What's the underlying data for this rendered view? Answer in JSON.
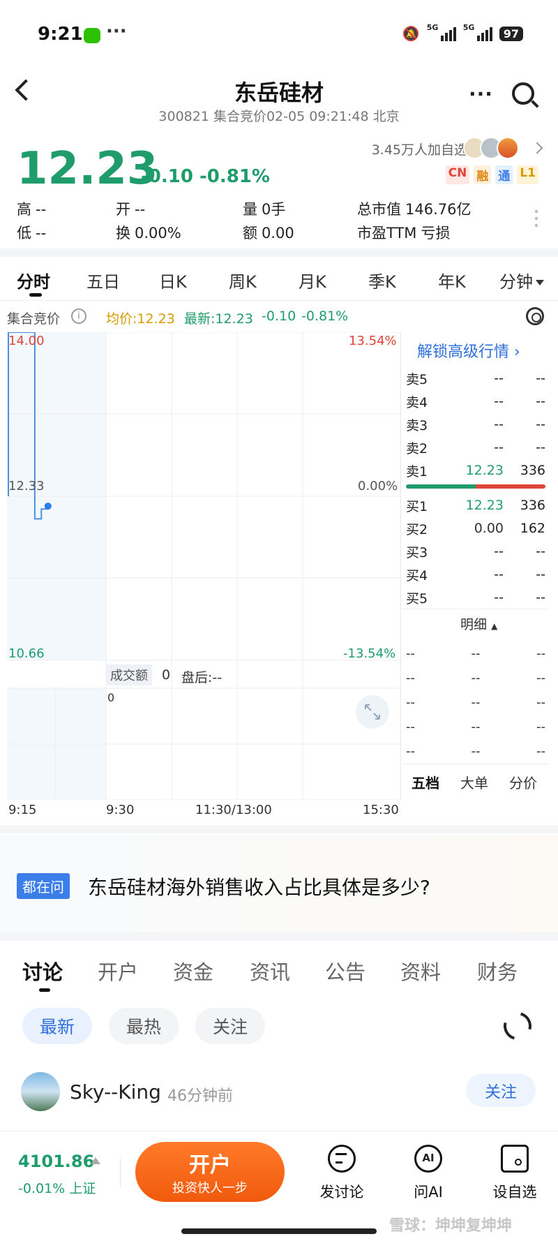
{
  "status": {
    "time": "9:21",
    "more": "···",
    "net1": "5G",
    "net2": "5G",
    "battery": "97"
  },
  "header": {
    "title": "东岳硅材",
    "subtitle": "300821 集合竞价02-05 09:21:48 北京",
    "more_dots": "···"
  },
  "quote": {
    "price": "12.23",
    "change": "-0.10 -0.81%",
    "followers": "3.45万人加自选",
    "badges": [
      "CN",
      "融",
      "通",
      "L1"
    ],
    "high_label": "高",
    "high": "--",
    "open_label": "开",
    "open": "--",
    "vol_label": "量",
    "vol": "0手",
    "mktcap_label": "总市值",
    "mktcap": "146.76亿",
    "low_label": "低",
    "low": "--",
    "turnover_label": "换",
    "turnover": "0.00%",
    "amount_label": "额",
    "amount": "0.00",
    "pe_label": "市盈TTM",
    "pe": "亏损"
  },
  "period_tabs": [
    "分时",
    "五日",
    "日K",
    "周K",
    "月K",
    "季K",
    "年K",
    "分钟"
  ],
  "chart_info": {
    "label": "集合竞价",
    "avg": "均价:12.23",
    "latest": "最新:12.23",
    "chg": "-0.10",
    "pct": "-0.81%"
  },
  "chart_axes": {
    "top_price": "14.00",
    "mid_price": "12.33",
    "low_price": "10.66",
    "top_pct": "13.54%",
    "mid_pct": "0.00%",
    "low_pct": "-13.54%",
    "vol_label": "成交额",
    "vol_value": "0",
    "after_label": "盘后:--",
    "vol_axis": "0",
    "times": [
      "9:15",
      "9:30",
      "11:30/13:00",
      "15:30"
    ]
  },
  "chart_data": {
    "type": "line",
    "x_label": "",
    "y_label": "",
    "ylim": [
      10.66,
      14.0
    ],
    "note_points": [
      {
        "x": "9:15",
        "y": 12.33
      },
      {
        "x": "9:15",
        "y": 13.4
      },
      {
        "x": "9:15",
        "y": 14.0
      },
      {
        "x": "9:19",
        "y": 14.0
      },
      {
        "x": "9:19",
        "y": 13.4
      },
      {
        "x": "9:19",
        "y": 12.1
      },
      {
        "x": "9:20",
        "y": 12.2
      },
      {
        "x": "9:21",
        "y": 12.23
      }
    ]
  },
  "order_book": {
    "unlock": "解锁高级行情",
    "asks": [
      {
        "label": "卖5",
        "price": "--",
        "vol": "--"
      },
      {
        "label": "卖4",
        "price": "--",
        "vol": "--"
      },
      {
        "label": "卖3",
        "price": "--",
        "vol": "--"
      },
      {
        "label": "卖2",
        "price": "--",
        "vol": "--"
      },
      {
        "label": "卖1",
        "price": "12.23",
        "vol": "336"
      }
    ],
    "bids": [
      {
        "label": "买1",
        "price": "12.23",
        "vol": "336"
      },
      {
        "label": "买2",
        "price": "0.00",
        "vol": "162"
      },
      {
        "label": "买3",
        "price": "--",
        "vol": "--"
      },
      {
        "label": "买4",
        "price": "--",
        "vol": "--"
      },
      {
        "label": "买5",
        "price": "--",
        "vol": "--"
      }
    ],
    "detail_label": "明细",
    "details": [
      [
        "--",
        "--",
        "--"
      ],
      [
        "--",
        "--",
        "--"
      ],
      [
        "--",
        "--",
        "--"
      ],
      [
        "--",
        "--",
        "--"
      ],
      [
        "--",
        "--",
        "--"
      ]
    ],
    "tabs": [
      "五档",
      "大单",
      "分价"
    ]
  },
  "question": {
    "tag": "都在问",
    "text": "东岳硅材海外销售收入占比具体是多少?"
  },
  "discussion_tabs": [
    "讨论",
    "开户",
    "资金",
    "资讯",
    "公告",
    "资料",
    "财务"
  ],
  "filters": [
    "最新",
    "最热",
    "关注"
  ],
  "post": {
    "user": "Sky--King",
    "time": "46分钟前",
    "follow": "关注"
  },
  "bottom": {
    "index_value": "4101.86",
    "index_change": "-0.01% 上证",
    "open_big": "开户",
    "open_small": "投资快人一步",
    "discuss": "发讨论",
    "ask_ai": "问AI",
    "ai_glyph": "AI",
    "watch": "设自选",
    "watermark": "雪球：坤坤复坤坤"
  },
  "colors": {
    "down_green": "#1f9c6b",
    "up_red": "#e0453a",
    "accent_blue": "#2f6fdc",
    "orange": "#f15a0c"
  }
}
